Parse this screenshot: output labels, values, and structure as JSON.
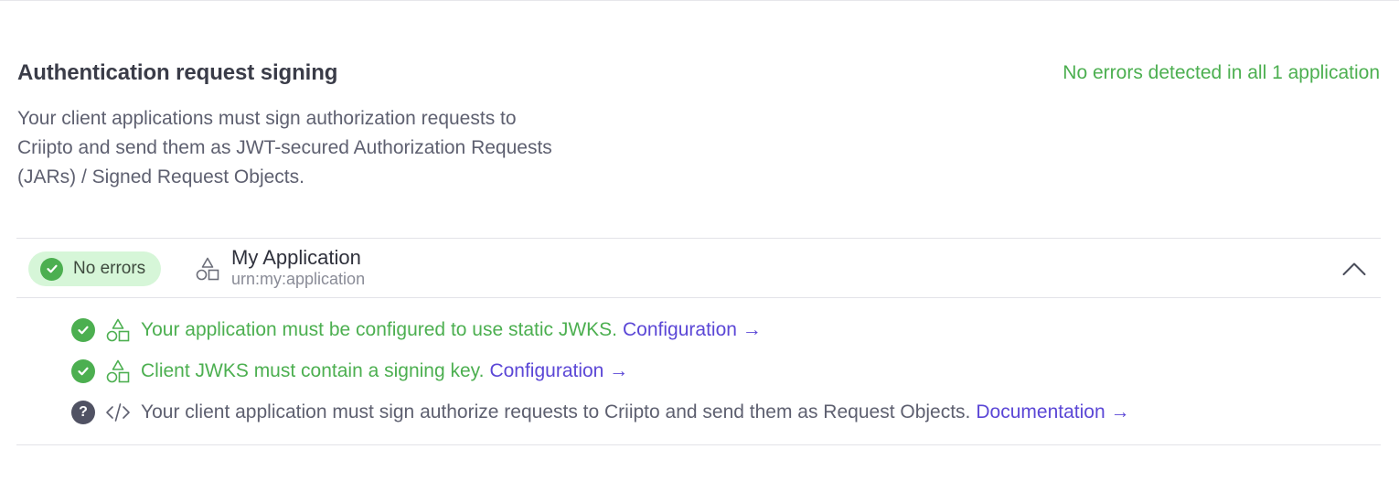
{
  "section": {
    "title": "Authentication request signing",
    "summary": "No errors detected in all 1 application",
    "description": "Your client applications must sign authorization requests to Criipto and send them as JWT-secured Authorization Requests (JARs) / Signed Request Objects."
  },
  "application": {
    "status_label": "No errors",
    "name": "My Application",
    "urn": "urn:my:application",
    "icon": "shapes-icon",
    "toggle_icon": "chevron-up-icon"
  },
  "checks": [
    {
      "status": "ok",
      "kind_icon": "shapes-icon",
      "text": "Your application must be configured to use static JWKS.",
      "link": "Configuration →"
    },
    {
      "status": "ok",
      "kind_icon": "shapes-icon",
      "text": "Client JWKS must contain a signing key.",
      "link": "Configuration →"
    },
    {
      "status": "unknown",
      "kind_icon": "code-icon",
      "status_glyph": "?",
      "text": "Your client application must sign authorize requests to Criipto and send them as Request Objects.",
      "link": "Documentation →"
    }
  ],
  "colors": {
    "success": "#4caf50",
    "success_bg": "#d6f6d8",
    "link": "#5b47d6",
    "neutral_status": "#505263"
  }
}
